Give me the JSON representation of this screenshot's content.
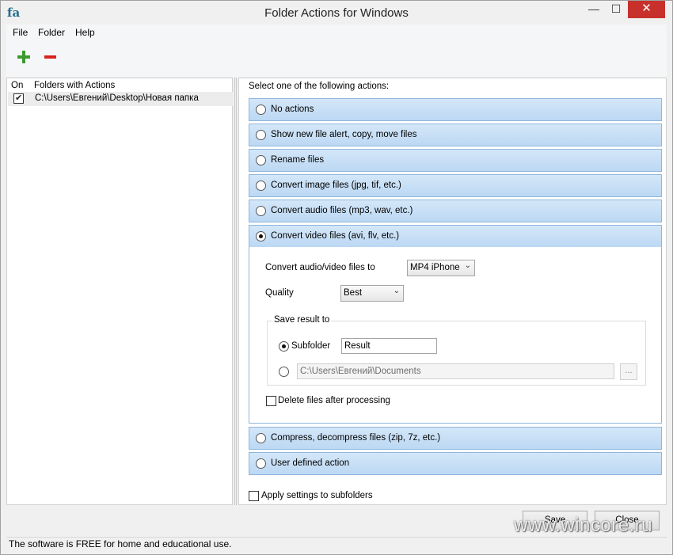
{
  "window": {
    "title": "Folder Actions for Windows",
    "icon_text": "fa",
    "controls": {
      "minimize": "—",
      "maximize": "☐",
      "close": "✕"
    }
  },
  "menu": {
    "items": [
      "File",
      "Folder",
      "Help"
    ]
  },
  "toolbar": {
    "add_icon": "plus-icon",
    "remove_icon": "minus-icon"
  },
  "left": {
    "col_on": "On",
    "col_folders": "Folders with Actions",
    "rows": [
      {
        "checked": true,
        "path": "C:\\Users\\Евгений\\Desktop\\Новая папка"
      }
    ]
  },
  "right": {
    "instruction": "Select one of the following actions:",
    "options_top": [
      {
        "label": "No actions",
        "selected": false
      },
      {
        "label": "Show new file alert, copy, move files",
        "selected": false
      },
      {
        "label": "Rename files",
        "selected": false
      },
      {
        "label": "Convert image files (jpg, tif, etc.)",
        "selected": false
      },
      {
        "label": "Convert audio files (mp3, wav, etc.)",
        "selected": false
      },
      {
        "label": "Convert video files (avi, flv, etc.)",
        "selected": true
      }
    ],
    "video": {
      "convert_label": "Convert audio/video files to",
      "format_value": "MP4 iPhone",
      "quality_label": "Quality",
      "quality_value": "Best",
      "save_group_title": "Save result to",
      "subfolder_label": "Subfolder",
      "subfolder_value": "Result",
      "path_value": "C:\\Users\\Евгений\\Documents",
      "browse_label": "...",
      "delete_label": "Delete files after processing"
    },
    "options_bottom": [
      {
        "label": "Compress, decompress files (zip, 7z, etc.)",
        "selected": false
      },
      {
        "label": "User defined action",
        "selected": false
      }
    ],
    "apply_label": "Apply settings to subfolders"
  },
  "buttons": {
    "save": "Save",
    "close": "Close"
  },
  "status": "The software is FREE for home and educational use.",
  "watermark": "www.wincore.ru",
  "colors": {
    "accent_bar": "#c8dff6",
    "close_red": "#c7302b",
    "add_green": "#3a9a2e",
    "remove_red": "#d8231e"
  }
}
